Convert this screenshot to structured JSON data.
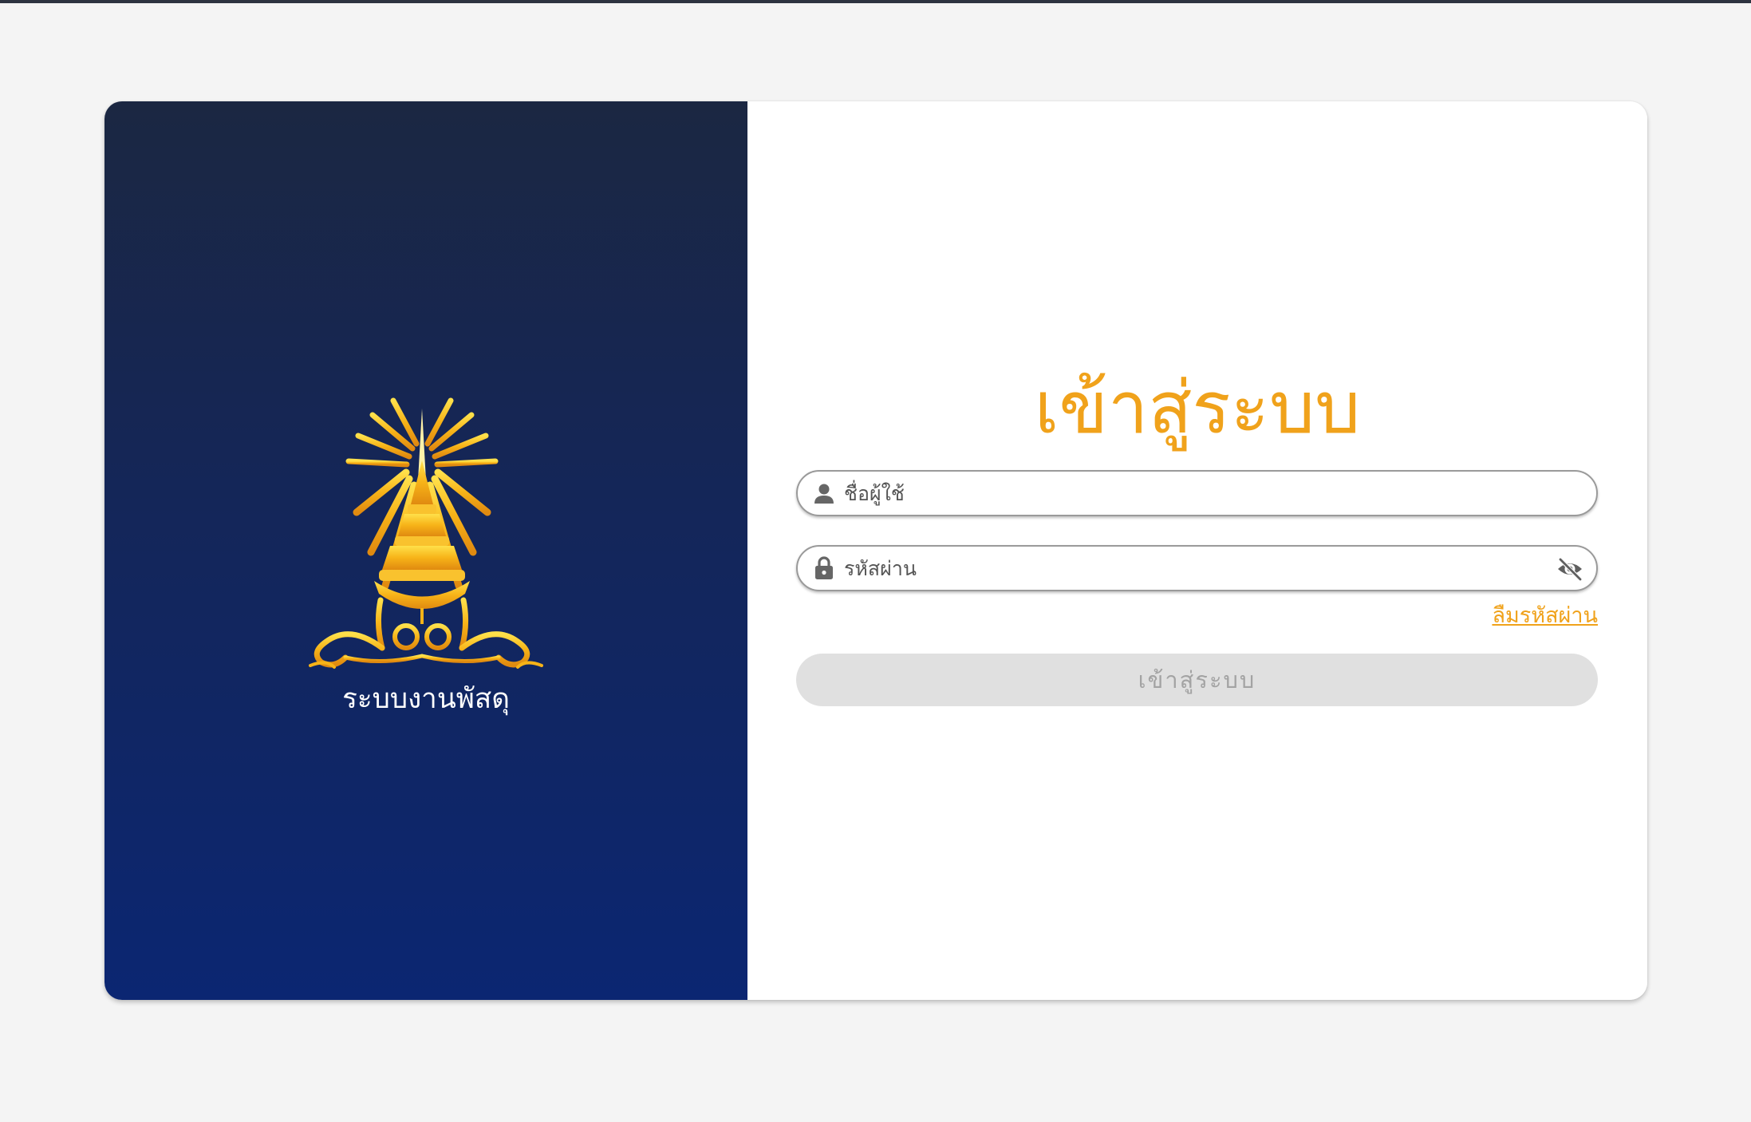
{
  "branding": {
    "system_name": "ระบบงานพัสดุ",
    "emblem_icon": "royal-crown-emblem"
  },
  "login": {
    "title": "เข้าสู่ระบบ",
    "username_placeholder": "ชื่อผู้ใช้",
    "username_value": "",
    "username_icon": "user-icon",
    "password_placeholder": "รหัสผ่าน",
    "password_value": "",
    "password_icon": "lock-icon",
    "visibility_icon": "eye-off-icon",
    "forgot_password_label": "ลืมรหัสผ่าน",
    "submit_label": "เข้าสู่ระบบ"
  },
  "colors": {
    "accent": "#f0a21b",
    "panel_top": "#1b2742",
    "panel_bottom": "#0b2672",
    "button_disabled_bg": "#e0e0e0",
    "button_disabled_text": "#a3a3a3"
  }
}
